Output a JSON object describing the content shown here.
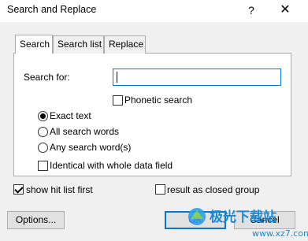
{
  "window": {
    "title": "Search and Replace",
    "help_label": "?",
    "close_label": "✕"
  },
  "tabs": [
    {
      "label": "Search",
      "active": true
    },
    {
      "label": "Search list",
      "active": false
    },
    {
      "label": "Replace",
      "active": false
    }
  ],
  "search": {
    "label": "Search for:",
    "value": "",
    "phonetic_label": "Phonetic search",
    "phonetic_checked": false
  },
  "match_mode": {
    "options": [
      {
        "label": "Exact text",
        "selected": true
      },
      {
        "label": "All search words",
        "selected": false
      },
      {
        "label": "Any search word(s)",
        "selected": false
      }
    ],
    "identical_label": "Identical with whole data field",
    "identical_checked": false
  },
  "options": {
    "show_hit_list_label": "show hit list first",
    "show_hit_list_checked": true,
    "closed_group_label": "result as closed group",
    "closed_group_checked": false
  },
  "buttons": {
    "options": "Options...",
    "ok": "OK",
    "cancel": "Cancel"
  },
  "watermark": {
    "text": "极光下载站",
    "url": "www.xz7.com"
  },
  "colors": {
    "accent": "#0078d7",
    "dialog_bg": "#f0f0f0"
  },
  "icons": {
    "help": "help-icon",
    "close": "close-icon"
  }
}
